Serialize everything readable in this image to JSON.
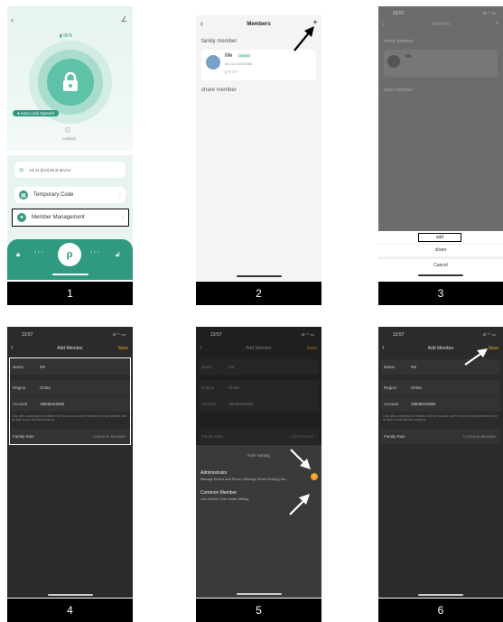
{
  "panel1": {
    "battery": "96%",
    "auto_lock": "Auto Lock Opened",
    "lock_state": "Locked",
    "notice": "13:44  [Ent]  Bind device",
    "temp_code": "Temporary Code",
    "member_mgmt": "Member Management",
    "caption": "1"
  },
  "panel2": {
    "title": "Members",
    "add": "+",
    "family_section": "family member",
    "member_name": "Me",
    "member_badge": "Admin",
    "member_account": "86-13144015668",
    "member_stats": "0   0   0",
    "share_section": "share member",
    "caption": "2"
  },
  "panel3": {
    "time": "13:57",
    "title": "Members",
    "family_section": "family member",
    "member_name": "Me",
    "share_section": "share member",
    "sheet_add": "add",
    "sheet_share": "share",
    "sheet_cancel": "Cancel",
    "caption": "3"
  },
  "panel4": {
    "time": "13:57",
    "title": "Add Member",
    "save": "Save",
    "name_label": "Name",
    "name_value": "SS",
    "region_label": "Region",
    "region_value": "China",
    "account_label": "Account",
    "account_value": "18848162584",
    "hint": "Only after accepting the invitation will the account owner become a family member and be able to use relevant functions.",
    "role_label": "Family Role",
    "role_value": "Common Member",
    "caption": "4"
  },
  "panel5": {
    "time": "13:57",
    "title": "Add Member",
    "save": "Save",
    "name_label": "Name",
    "name_value": "SS",
    "region_label": "Region",
    "region_value": "China",
    "account_label": "Account",
    "account_value": "18848162584",
    "role_label": "Family Role",
    "role_value": "Administrator",
    "sheet_title": "Role Setting",
    "admin_title": "Administrator",
    "admin_desc": "Manage Device and Room | Manage Smart Setting | Ma...",
    "common_title": "Common Member",
    "common_desc": "Use Device | Use Smart Setting",
    "caption": "5"
  },
  "panel6": {
    "time": "13:57",
    "title": "Add Member",
    "save": "Save",
    "name_label": "Name",
    "name_value": "SS",
    "region_label": "Region",
    "region_value": "China",
    "account_label": "Account",
    "account_value": "18848162584",
    "hint": "Only after accepting the invitation will the account owner become a family member and be able to use relevant functions.",
    "role_label": "Family Role",
    "role_value": "Common Member",
    "caption": "6"
  },
  "colors": {
    "teal": "#2f9a80",
    "save_orange": "#f0a020",
    "dark_bg": "#2a2a2a"
  }
}
